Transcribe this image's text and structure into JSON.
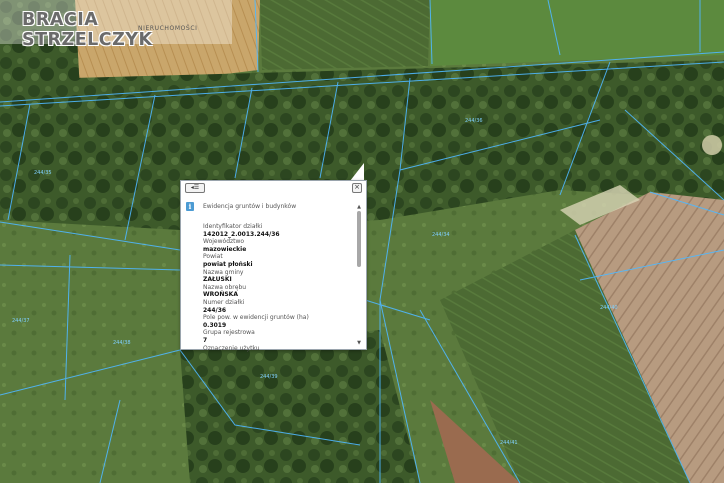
{
  "brand": {
    "title": "BRACIA STRZELCZYK",
    "subtitle": "NIERUCHOMOŚCI"
  },
  "map": {
    "parcel_labels": [
      "244/36",
      "244/35",
      "244/34",
      "244/37",
      "244/38",
      "244/39",
      "244/40",
      "244/41"
    ]
  },
  "popup": {
    "layer_title": "Ewidencja gruntów i budynków",
    "nav_icon": "list-back-icon",
    "close_icon": "close-icon",
    "info_icon": "info-icon",
    "fields": [
      {
        "label": "Identyfikator działki",
        "value": "142012_2.0013.244/36"
      },
      {
        "label": "Województwo",
        "value": "mazowieckie"
      },
      {
        "label": "Powiat",
        "value": "powiat płoński"
      },
      {
        "label": "Nazwa gminy",
        "value": "ZAŁUSKI"
      },
      {
        "label": "Nazwa obrębu",
        "value": "WROŃSKA"
      },
      {
        "label": "Numer działki",
        "value": "244/36"
      },
      {
        "label": "Pole pow. w ewidencji gruntów (ha)",
        "value": "0.3019"
      },
      {
        "label": "Grupa rejestrowa",
        "value": "7"
      },
      {
        "label": "Oznaczenie użytku",
        "value": ""
      }
    ]
  },
  "colors": {
    "parcel_line": "#4fb8ff",
    "popup_bg": "#ffffff",
    "info_icon": "#4c9bd3"
  }
}
